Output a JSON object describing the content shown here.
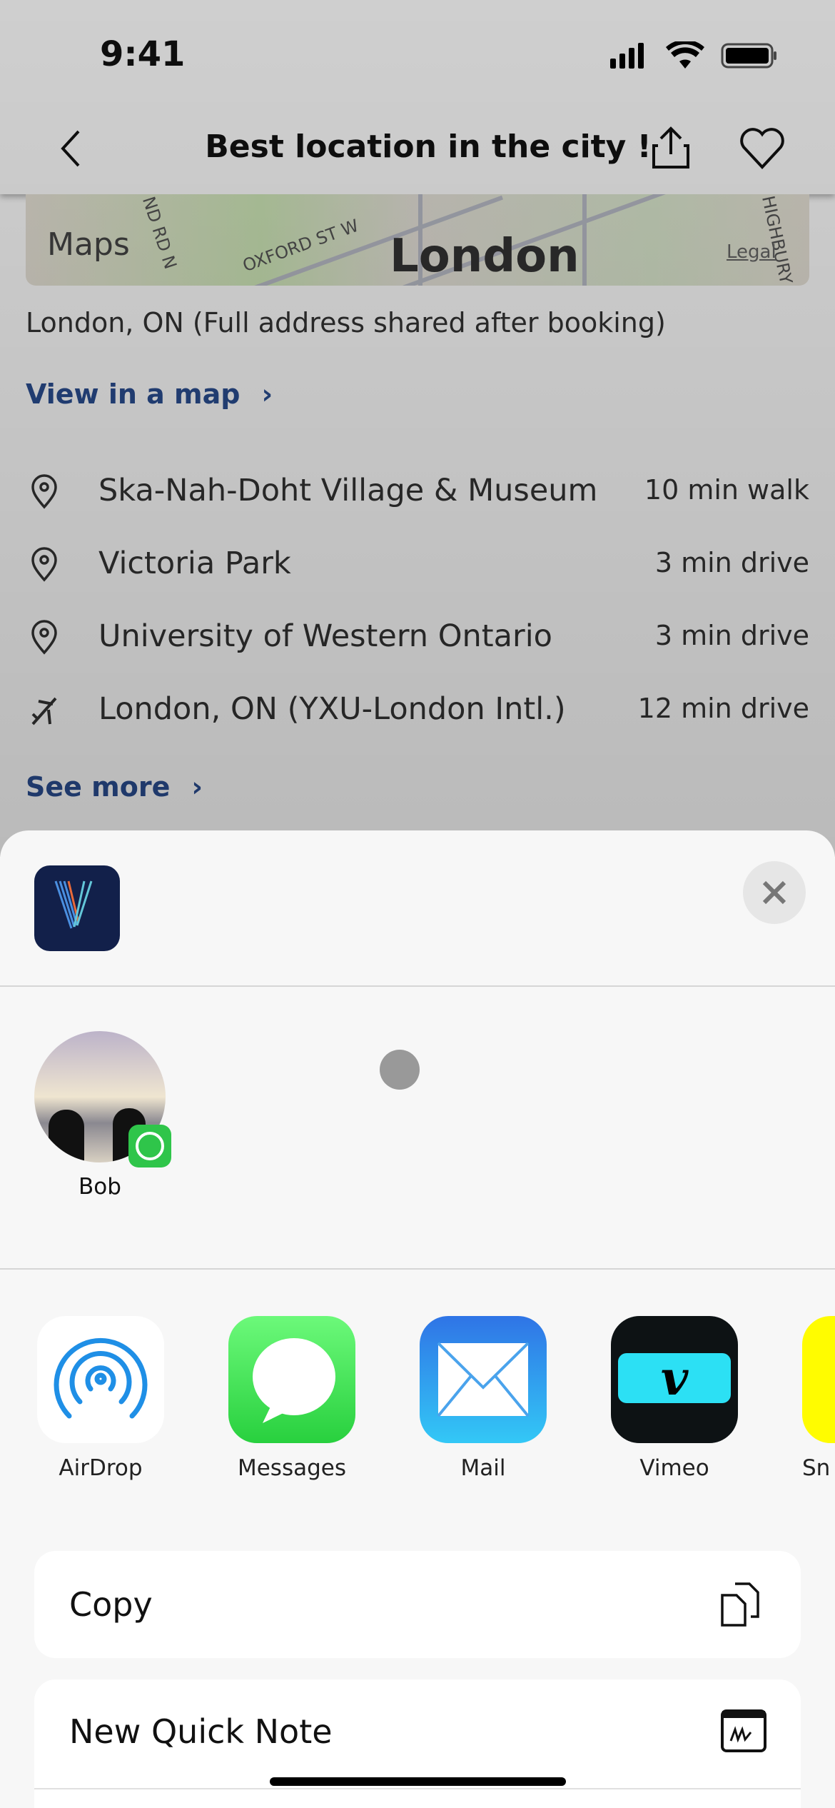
{
  "status_bar": {
    "time": "9:41"
  },
  "nav": {
    "title": "Best location in the city !"
  },
  "map": {
    "brand": "Maps",
    "city": "London",
    "legal": "Legal",
    "streets": [
      "OXFORD ST W",
      "ND RD N",
      "HIGHBURY"
    ]
  },
  "location": {
    "address": "London, ON (Full address shared after booking)",
    "view_map": "View in a map",
    "places": [
      {
        "name": "Ska-Nah-Doht Village & Museum",
        "distance": "10 min walk",
        "icon": "pin-icon"
      },
      {
        "name": "Victoria Park",
        "distance": "3 min drive",
        "icon": "pin-icon"
      },
      {
        "name": "University of Western Ontario",
        "distance": "3 min drive",
        "icon": "pin-icon"
      },
      {
        "name": "London, ON (YXU-London Intl.)",
        "distance": "12 min drive",
        "icon": "airplane-icon"
      }
    ],
    "see_more": "See more"
  },
  "share_sheet": {
    "contact": {
      "name": "Bob"
    },
    "apps": [
      {
        "label": "AirDrop"
      },
      {
        "label": "Messages"
      },
      {
        "label": "Mail"
      },
      {
        "label": "Vimeo"
      },
      {
        "label": "Sn"
      }
    ],
    "actions": [
      {
        "label": "Copy",
        "icon": "copy-icon"
      },
      {
        "label": "New Quick Note",
        "icon": "quick-note-icon"
      }
    ]
  }
}
